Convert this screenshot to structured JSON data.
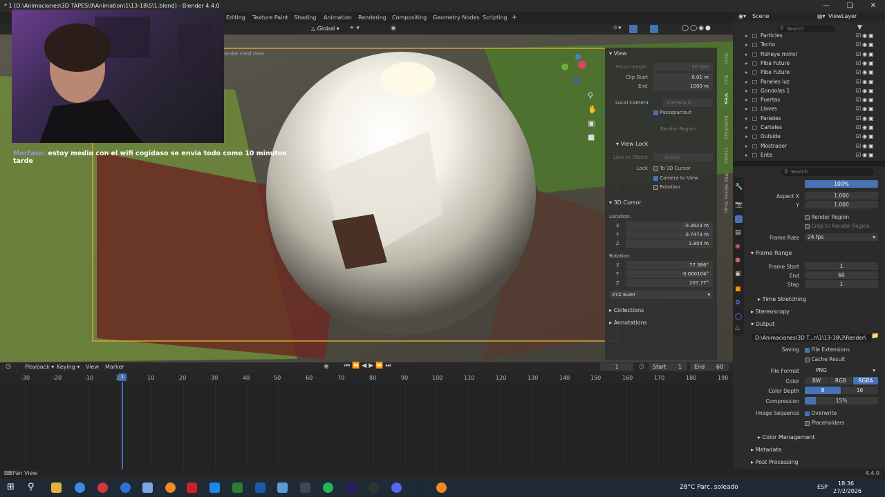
{
  "title": "* 1 [D:\\Animaciones\\3D TAPES\\9\\Animation\\1\\13-18\\5\\1.blend] - Blender 4.4.0",
  "workspaces": [
    "Editing",
    "Texture Paint",
    "Shading",
    "Animation",
    "Rendering",
    "Compositing",
    "Geometry Nodes",
    "Scripting"
  ],
  "viewport_header": {
    "orientation": "Global",
    "options": "Options"
  },
  "overlay_text": "Render Field View",
  "npanel": {
    "tabs": [
      "Item",
      "Tool",
      "View",
      "Sketchfab",
      "Create",
      "PSX Vertex Snap"
    ],
    "view_title": "View",
    "focal_length_label": "Focal Length",
    "focal_length": "50 mm",
    "clip_start_label": "Clip Start",
    "clip_start": "0.01 m",
    "end_label": "End",
    "clip_end": "1000 m",
    "local_camera_label": "Local Camera",
    "local_camera_value": "Camera.0...",
    "passepartout": "Passepartout",
    "render_region": "Render Region",
    "view_lock_title": "View Lock",
    "lock_to_object_label": "Lock to Object",
    "lock_to_object_value": "Object",
    "lock_label": "Lock",
    "to_3d_cursor": "To 3D Cursor",
    "camera_to_view": "Camera to View",
    "rotation_lock": "Rotation",
    "cursor_title": "3D Cursor",
    "location_label": "Location:",
    "loc_x": "-0.3623 m",
    "loc_y": "0.7473 m",
    "loc_z": "1.854 m",
    "rotation_label": "Rotation:",
    "rot_x": "77.386°",
    "rot_y": "-0.000104°",
    "rot_z": "207.77°",
    "rot_mode": "XYZ Euler",
    "x": "X",
    "y": "Y",
    "z": "Z",
    "collections": "Collections",
    "annotations": "Annotations"
  },
  "timeline": {
    "menus": [
      "Playback",
      "Keying",
      "View",
      "Marker"
    ],
    "current_frame": "1",
    "start_label": "Start",
    "start": "1",
    "end_label": "End",
    "end": "60",
    "ruler": [
      "-30",
      "-20",
      "-10",
      "1",
      "10",
      "20",
      "30",
      "40",
      "50",
      "60",
      "70",
      "80",
      "90",
      "100",
      "110",
      "120",
      "130",
      "140",
      "150",
      "160",
      "170",
      "180",
      "190"
    ]
  },
  "status": {
    "left": "Pan View",
    "version": "4.4.0"
  },
  "outliner": {
    "scene": "Scene",
    "view_layer": "ViewLayer",
    "search_placeholder": "Search",
    "items": [
      "Particles",
      "Techo",
      "Fisheye mirror",
      "Piba Future",
      "Pibe Future",
      "Paneles luz",
      "Gondolas 1",
      "Puertas",
      "Llaves",
      "Paredes",
      "Carteles",
      "Outside",
      "Mostrador",
      "Ente"
    ]
  },
  "props": {
    "search_placeholder": "Search",
    "percent_label": "%",
    "percent": "100%",
    "aspect_x_label": "Aspect X",
    "aspect_x": "1.000",
    "y_label": "Y",
    "aspect_y": "1.000",
    "render_region": "Render Region",
    "crop": "Crop to Render Region",
    "frame_rate_label": "Frame Rate",
    "frame_rate": "24 fps",
    "frame_range_title": "Frame Range",
    "frame_start_label": "Frame Start",
    "frame_start": "1",
    "end_label": "End",
    "frame_end": "60",
    "step_label": "Step",
    "step": "1",
    "time_stretching": "Time Stretching",
    "stereoscopy": "Stereoscopy",
    "output_title": "Output",
    "output_path": "D:\\Animaciones\\3D T...n\\1\\13-18\\3\\Render\\",
    "saving_label": "Saving",
    "file_extensions": "File Extensions",
    "cache_result": "Cache Result",
    "file_format_label": "File Format",
    "file_format": "PNG",
    "color_label": "Color",
    "color_opts": [
      "BW",
      "RGB",
      "RGBA"
    ],
    "color_depth_label": "Color Depth",
    "depth_opts": [
      "8",
      "16"
    ],
    "compression_label": "Compression",
    "compression": "15%",
    "image_sequence_label": "Image Sequence",
    "overwrite": "Overwrite",
    "placeholders": "Placeholders",
    "color_management": "Color Management",
    "metadata": "Metadata",
    "post_processing": "Post Processing"
  },
  "chat": {
    "user": "Merfaso:",
    "message": "estoy medio con el wifi cogidaso se envia todo como 10 minutos tarde"
  },
  "taskbar": {
    "weather": "28°C  Parc. soleado",
    "lang": "ESP",
    "time": "18:36",
    "date": "27/2/2026"
  },
  "colors": {
    "accent": "#4772b3",
    "keyframe": "#4772b3"
  }
}
